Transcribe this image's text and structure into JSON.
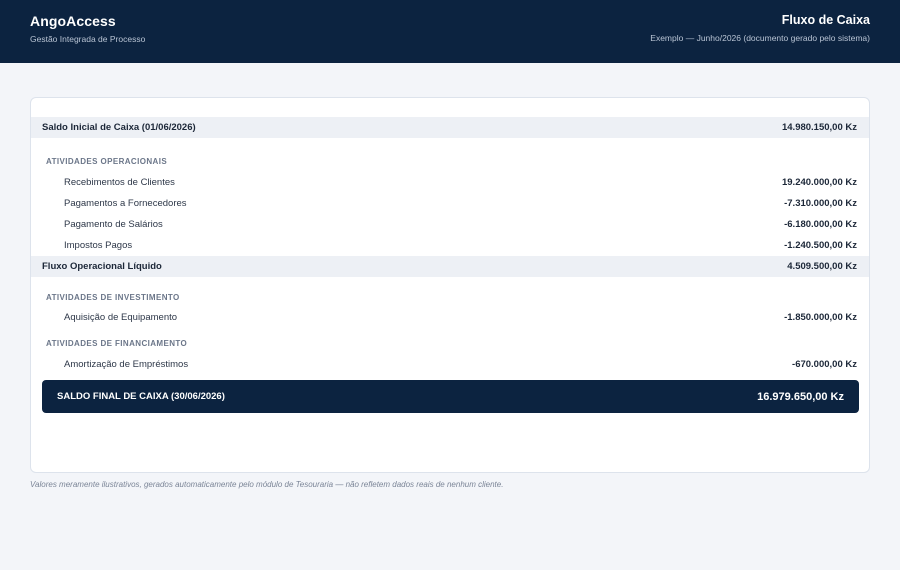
{
  "header": {
    "brand": "AngoAccess",
    "brand_subtitle": "Gestão Integrada de Processo",
    "title": "Fluxo de Caixa",
    "subtitle": "Exemplo — Junho/2026 (documento gerado pelo sistema)"
  },
  "statement": {
    "opening": {
      "label": "Saldo Inicial de Caixa (01/06/2026)",
      "amount": "14.980.150,00 Kz"
    },
    "operating": {
      "title": "ATIVIDADES OPERACIONAIS",
      "items": [
        {
          "label": "Recebimentos de Clientes",
          "amount": "19.240.000,00 Kz"
        },
        {
          "label": "Pagamentos a Fornecedores",
          "amount": "-7.310.000,00 Kz"
        },
        {
          "label": "Pagamento de Salários",
          "amount": "-6.180.000,00 Kz"
        },
        {
          "label": "Impostos Pagos",
          "amount": "-1.240.500,00 Kz"
        }
      ],
      "net": {
        "label": "Fluxo Operacional Líquido",
        "amount": "4.509.500,00 Kz"
      }
    },
    "investing": {
      "title": "ATIVIDADES DE INVESTIMENTO",
      "items": [
        {
          "label": "Aquisição de Equipamento",
          "amount": "-1.850.000,00 Kz"
        }
      ]
    },
    "financing": {
      "title": "ATIVIDADES DE FINANCIAMENTO",
      "items": [
        {
          "label": "Amortização de Empréstimos",
          "amount": "-670.000,00 Kz"
        }
      ]
    },
    "closing": {
      "label": "SALDO FINAL DE CAIXA (30/06/2026)",
      "amount": "16.979.650,00 Kz"
    }
  },
  "footnote": "Valores meramente ilustrativos, gerados automaticamente pelo módulo de Tesouraria — não refletem dados reais de nenhum cliente."
}
